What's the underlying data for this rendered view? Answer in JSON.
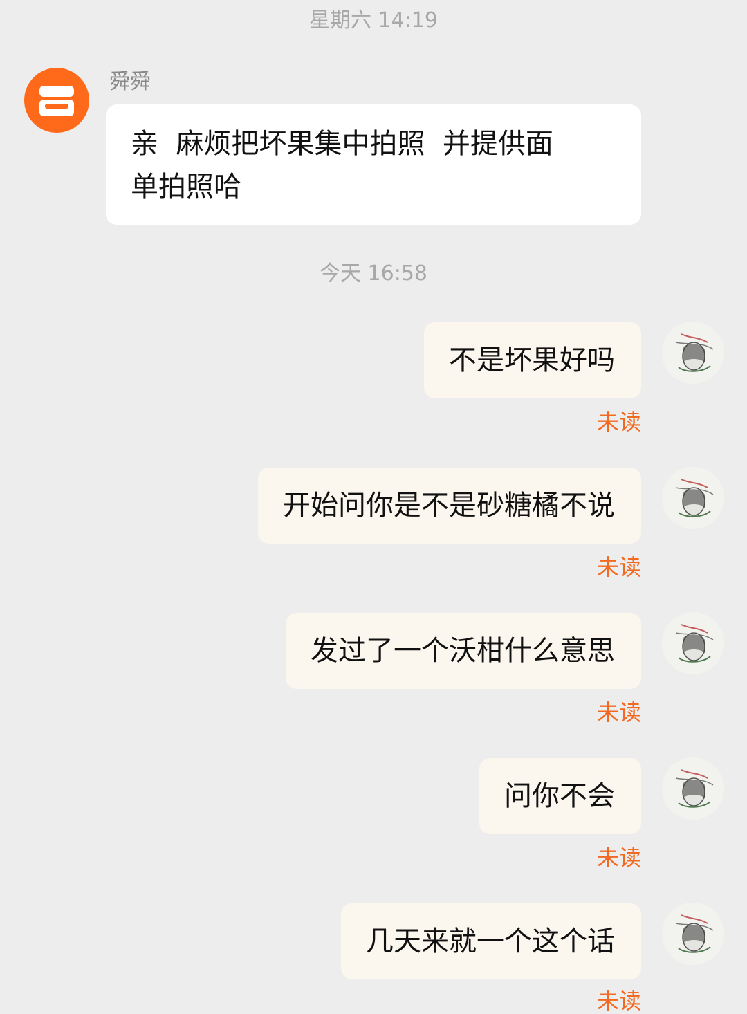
{
  "conversation": {
    "timestamps": [
      "星期六 14:19",
      "今天 16:58"
    ],
    "contact": {
      "name": "舜舜",
      "avatar_icon": "shop-icon",
      "avatar_color": "#ff6a1a"
    },
    "incoming_messages": [
      {
        "line1": "亲  麻烦把坏果集中拍照  并提供面",
        "line2": "单拍照哈"
      }
    ],
    "outgoing_messages": [
      {
        "text": "不是坏果好吗",
        "status": "未读"
      },
      {
        "text": "开始问你是不是砂糖橘不说",
        "status": "未读"
      },
      {
        "text": "发过了一个沃柑什么意思",
        "status": "未读"
      },
      {
        "text": "问你不会",
        "status": "未读"
      },
      {
        "text": "几天来就一个这个话",
        "status": "未读"
      }
    ],
    "colors": {
      "background": "#ededed",
      "incoming_bubble": "#ffffff",
      "outgoing_bubble": "#fbf6ee",
      "unread_status": "#f26a21",
      "timestamp_text": "#a8a8a8"
    }
  }
}
